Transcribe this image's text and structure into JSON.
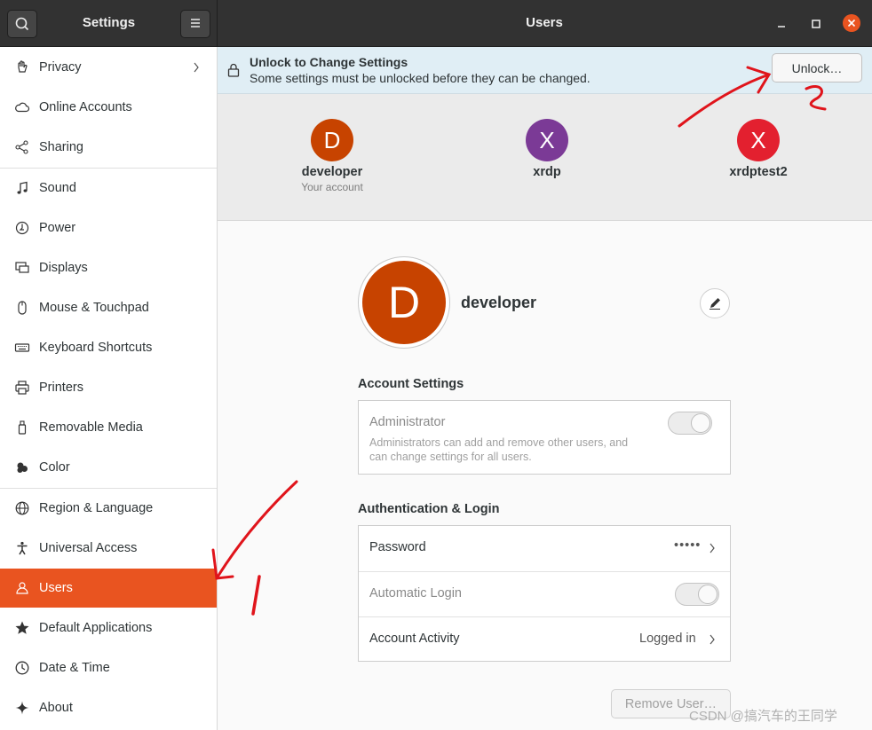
{
  "window": {
    "sidebar_title": "Settings",
    "title": "Users",
    "controls": {
      "minimize": "–",
      "maximize": "□",
      "close": "×"
    }
  },
  "sidebar": {
    "items": [
      {
        "label": "Privacy",
        "icon": "hand-icon"
      },
      {
        "label": "Online Accounts",
        "icon": "cloud-icon"
      },
      {
        "label": "Sharing",
        "icon": "share-icon"
      },
      {
        "label": "Sound",
        "icon": "music-note-icon"
      },
      {
        "label": "Power",
        "icon": "power-icon"
      },
      {
        "label": "Displays",
        "icon": "display-icon"
      },
      {
        "label": "Mouse & Touchpad",
        "icon": "mouse-icon"
      },
      {
        "label": "Keyboard Shortcuts",
        "icon": "keyboard-icon"
      },
      {
        "label": "Printers",
        "icon": "printer-icon"
      },
      {
        "label": "Removable Media",
        "icon": "usb-drive-icon"
      },
      {
        "label": "Color",
        "icon": "palette-icon"
      },
      {
        "label": "Region & Language",
        "icon": "globe-icon"
      },
      {
        "label": "Universal Access",
        "icon": "accessibility-icon"
      },
      {
        "label": "Users",
        "icon": "users-icon",
        "active": true
      },
      {
        "label": "Default Applications",
        "icon": "star-icon"
      },
      {
        "label": "Date & Time",
        "icon": "clock-icon"
      },
      {
        "label": "About",
        "icon": "sparkle-icon"
      }
    ]
  },
  "infobar": {
    "title": "Unlock to Change Settings",
    "subtitle": "Some settings must be unlocked before they can be changed.",
    "unlock_label": "Unlock…"
  },
  "users": [
    {
      "initial": "D",
      "name": "developer",
      "subtitle": "Your account",
      "color": "#c74300"
    },
    {
      "initial": "X",
      "name": "xrdp",
      "subtitle": "",
      "color": "#7b3a96"
    },
    {
      "initial": "X",
      "name": "xrdptest2",
      "subtitle": "",
      "color": "#e3202f"
    }
  ],
  "selected_user": {
    "initial": "D",
    "name": "developer"
  },
  "account_settings": {
    "heading": "Account Settings",
    "admin_label": "Administrator",
    "admin_desc_1": "Administrators can add and remove other users, and",
    "admin_desc_2": "can change settings for all users.",
    "admin_enabled": false
  },
  "auth": {
    "heading": "Authentication & Login",
    "password_label": "Password",
    "password_value": "•••••",
    "auto_login_label": "Automatic Login",
    "auto_login_enabled": false,
    "activity_label": "Account Activity",
    "activity_value": "Logged in"
  },
  "remove_user_label": "Remove User…",
  "watermark": "CSDN @搞汽车的王同学",
  "colors": {
    "accent": "#e95420",
    "headerbar": "#323232",
    "infobar": "#e0eef5"
  }
}
